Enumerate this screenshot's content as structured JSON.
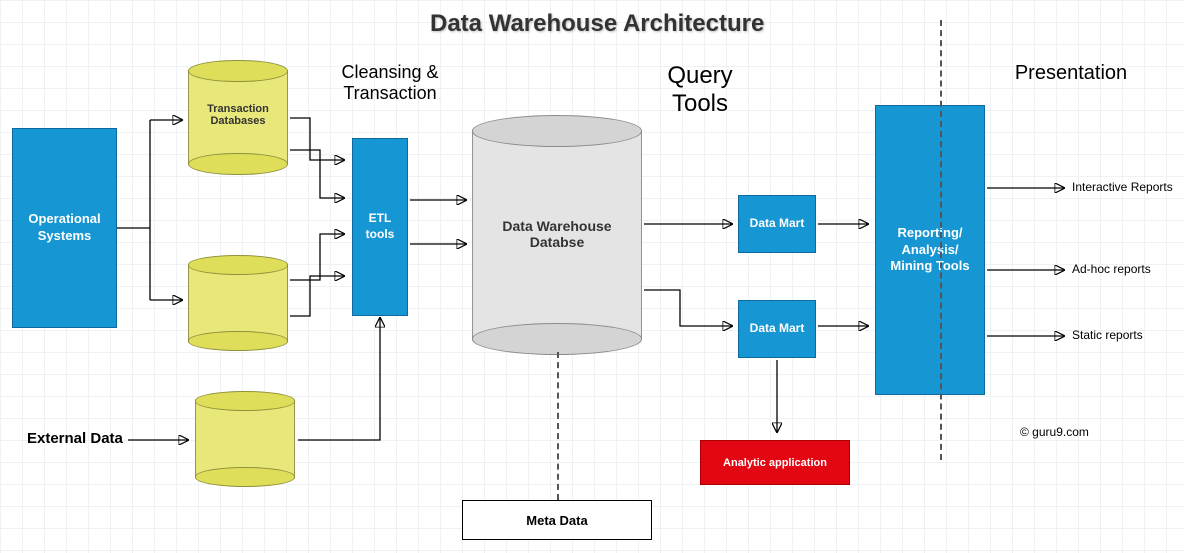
{
  "title": "Data Warehouse Architecture",
  "labels": {
    "cleansing": "Cleansing &\nTransaction",
    "query_tools": "Query\nTools",
    "presentation": "Presentation",
    "external_data": "External Data",
    "meta_data": "Meta Data",
    "copyright": "© guru9.com"
  },
  "boxes": {
    "operational_systems": "Operational\nSystems",
    "etl_tools": "ETL\ntools",
    "data_mart_top": "Data Mart",
    "data_mart_bottom": "Data Mart",
    "reporting": "Reporting/\nAnalysis/\nMining Tools",
    "analytic_app": "Analytic application"
  },
  "cylinders": {
    "transaction_db": "Transaction\nDatabases",
    "unnamed_db": "",
    "external_db": "",
    "dw_db": "Data Warehouse\nDatabse"
  },
  "outputs": {
    "interactive": "Interactive Reports",
    "adhoc": "Ad-hoc reports",
    "static": "Static reports"
  }
}
